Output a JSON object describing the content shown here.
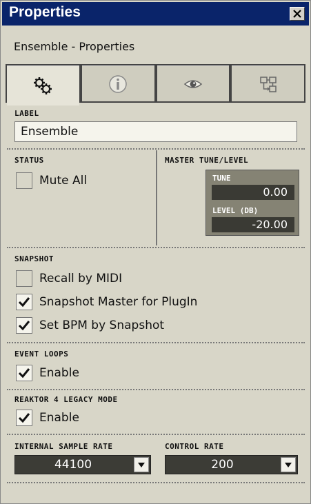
{
  "window": {
    "title": "Properties",
    "subtitle": "Ensemble - Properties"
  },
  "tabs": [
    {
      "icon": "gears-icon",
      "active": true
    },
    {
      "icon": "info-icon",
      "active": false
    },
    {
      "icon": "eye-icon",
      "active": false
    },
    {
      "icon": "connections-icon",
      "active": false
    }
  ],
  "label_section": {
    "heading": "LABEL",
    "value": "Ensemble"
  },
  "status_section": {
    "heading": "STATUS",
    "mute_all": {
      "label": "Mute All",
      "checked": false
    }
  },
  "master_section": {
    "heading": "MASTER TUNE/LEVEL",
    "tune_label": "TUNE",
    "tune_value": "0.00",
    "level_label": "LEVEL (DB)",
    "level_value": "-20.00"
  },
  "snapshot_section": {
    "heading": "SNAPSHOT",
    "recall_by_midi": {
      "label": "Recall by MIDI",
      "checked": false
    },
    "snapshot_master": {
      "label": "Snapshot Master for PlugIn",
      "checked": true
    },
    "set_bpm": {
      "label": "Set BPM by Snapshot",
      "checked": true
    }
  },
  "event_loops_section": {
    "heading": "EVENT LOOPS",
    "enable": {
      "label": "Enable",
      "checked": true
    }
  },
  "legacy_section": {
    "heading": "REAKTOR 4 LEGACY MODE",
    "enable": {
      "label": "Enable",
      "checked": true
    }
  },
  "rates_section": {
    "sample_rate_heading": "INTERNAL SAMPLE RATE",
    "sample_rate_value": "44100",
    "control_rate_heading": "CONTROL RATE",
    "control_rate_value": "200"
  },
  "colors": {
    "titlebar": "#0a246a",
    "panel": "#d8d6c8",
    "value_box": "#3a3a34"
  }
}
